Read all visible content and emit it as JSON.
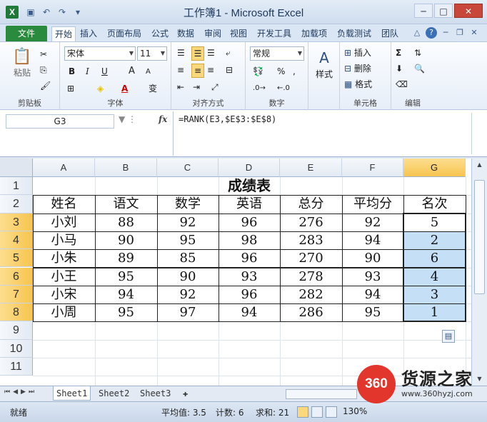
{
  "window": {
    "title": "工作簿1 - Microsoft Excel",
    "app_icon": "X"
  },
  "menu": {
    "file": "文件",
    "tabs": [
      "开始",
      "插入",
      "页面布局",
      "公式",
      "数据",
      "审阅",
      "视图",
      "开发工具",
      "加载项",
      "负载测试",
      "团队"
    ],
    "active_tab": "开始"
  },
  "ribbon": {
    "clipboard": {
      "paste": "粘贴",
      "label": "剪贴板"
    },
    "font": {
      "name": "宋体",
      "size": "11",
      "bold": "B",
      "italic": "I",
      "underline": "U",
      "grow": "A",
      "shrink": "A",
      "wen": "变",
      "label": "字体"
    },
    "alignment": {
      "label": "对齐方式"
    },
    "number": {
      "format": "常规",
      "percent": "%",
      "comma": ",",
      "label": "数字"
    },
    "styles": {
      "label": "样式"
    },
    "cells": {
      "insert": "插入",
      "delete": "删除",
      "format": "格式",
      "label": "单元格"
    },
    "editing": {
      "sum": "Σ",
      "label": "编辑"
    }
  },
  "formula_bar": {
    "name_box": "G3",
    "fx": "fx",
    "formula": "=RANK(E3,$E$3:$E$8)"
  },
  "sheet": {
    "columns": [
      "A",
      "B",
      "C",
      "D",
      "E",
      "F",
      "G"
    ],
    "selected_column": "G",
    "rows": [
      "1",
      "2",
      "3",
      "4",
      "5",
      "6",
      "7",
      "8",
      "9",
      "10",
      "11"
    ],
    "selected_rows": [
      "3",
      "4",
      "5",
      "6",
      "7",
      "8"
    ],
    "title": "成绩表",
    "headers": [
      "姓名",
      "语文",
      "数学",
      "英语",
      "总分",
      "平均分",
      "名次"
    ],
    "data": [
      [
        "小刘",
        "88",
        "92",
        "96",
        "276",
        "92",
        "5"
      ],
      [
        "小马",
        "90",
        "95",
        "98",
        "283",
        "94",
        "2"
      ],
      [
        "小朱",
        "89",
        "85",
        "96",
        "270",
        "90",
        "6"
      ],
      [
        "小王",
        "95",
        "90",
        "93",
        "278",
        "93",
        "4"
      ],
      [
        "小宋",
        "94",
        "92",
        "96",
        "282",
        "94",
        "3"
      ],
      [
        "小周",
        "95",
        "97",
        "94",
        "286",
        "95",
        "1"
      ]
    ]
  },
  "sheet_tabs": [
    "Sheet1",
    "Sheet2",
    "Sheet3"
  ],
  "active_sheet": "Sheet1",
  "status": {
    "ready": "就绪",
    "average": "平均值: 3.5",
    "count": "计数: 6",
    "sum": "求和: 21",
    "zoom": "130%"
  },
  "watermark": {
    "logo": "360",
    "name": "货源之家",
    "url": "www.360hyzj.com"
  },
  "colors": {
    "file_tab": "#2a8a3e",
    "selection_fill": "#c5dff7",
    "header_highlight": "#f7c44f",
    "watermark_red": "#e2362d"
  }
}
